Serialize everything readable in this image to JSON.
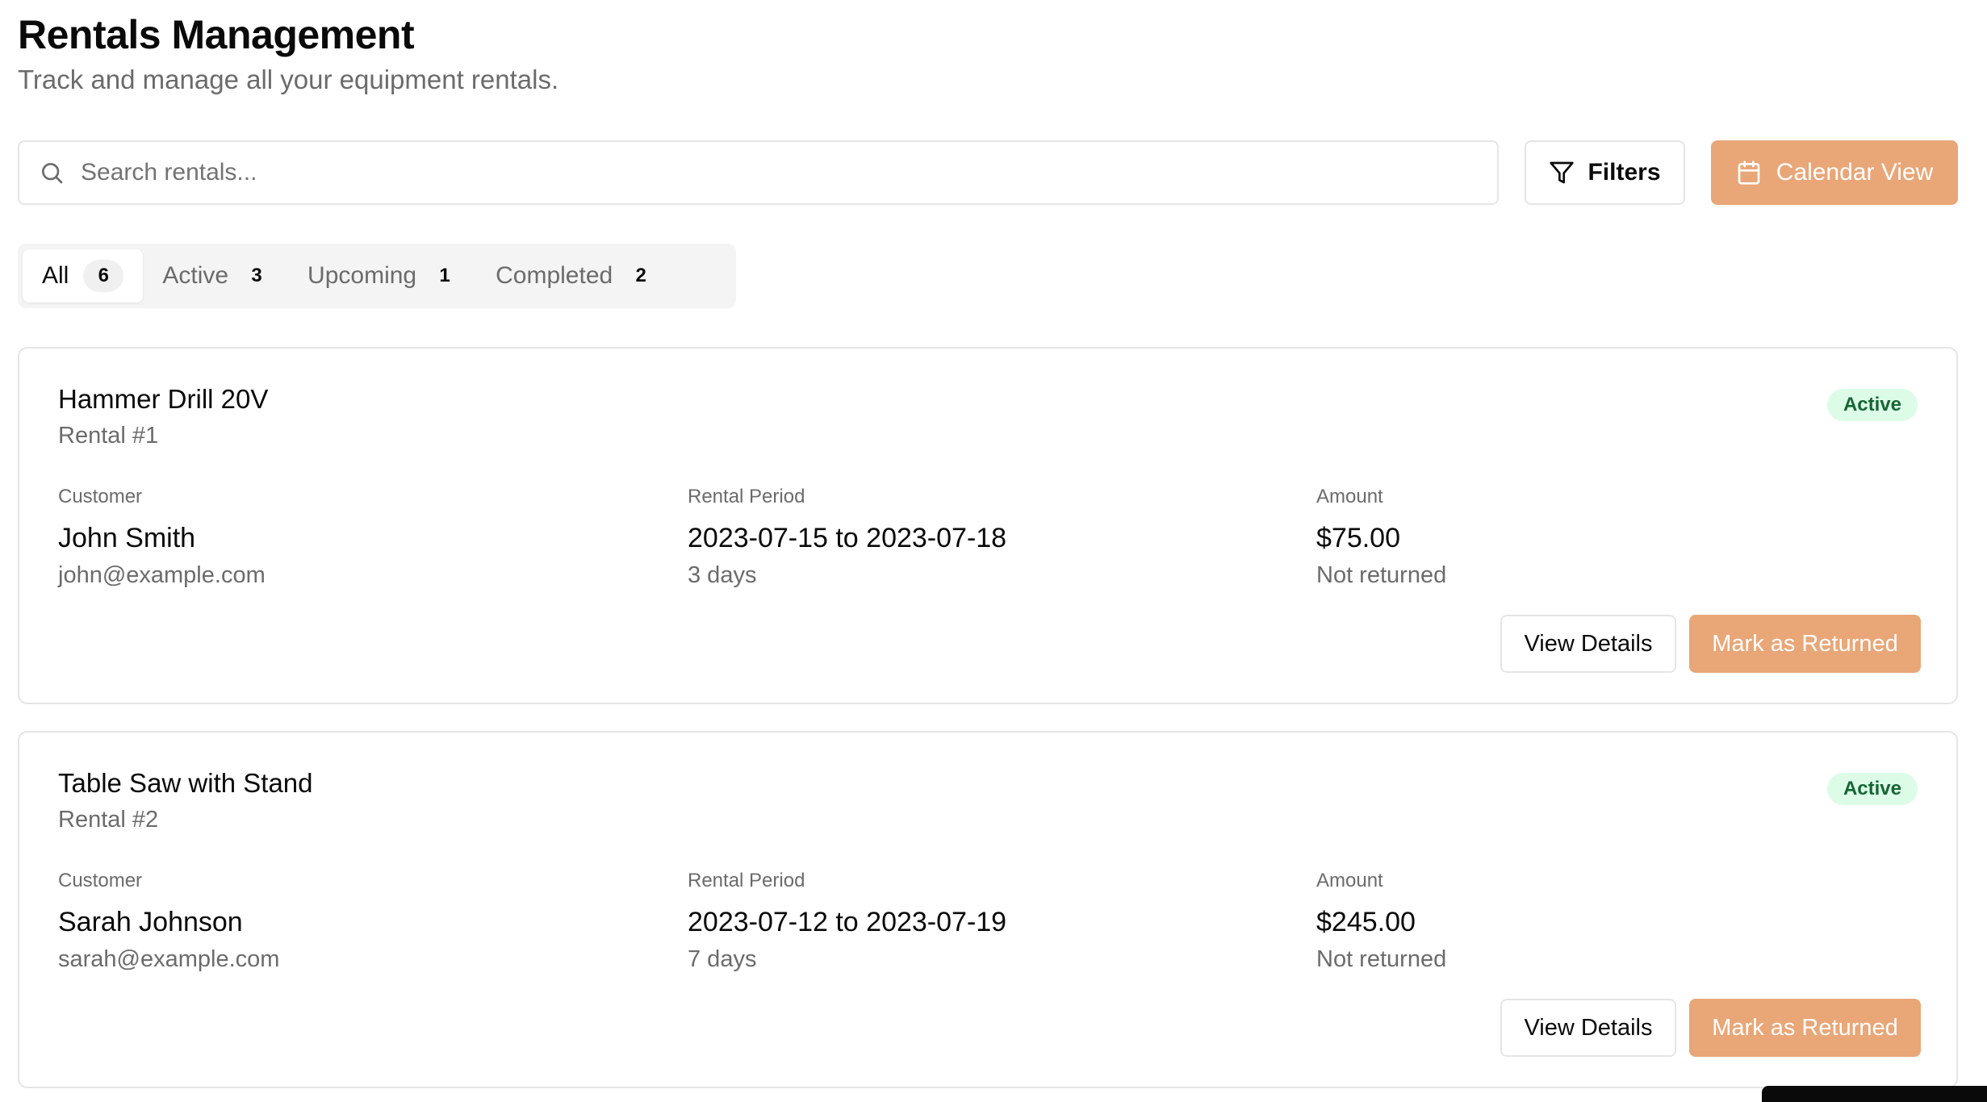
{
  "header": {
    "title": "Rentals Management",
    "subtitle": "Track and manage all your equipment rentals."
  },
  "toolbar": {
    "search_placeholder": "Search rentals...",
    "search_icon": "search-icon",
    "filters_label": "Filters",
    "filters_icon": "filter-icon",
    "calendar_label": "Calendar View",
    "calendar_icon": "calendar-icon"
  },
  "tabs": [
    {
      "label": "All",
      "count": "6",
      "active": true
    },
    {
      "label": "Active",
      "count": "3",
      "active": false
    },
    {
      "label": "Upcoming",
      "count": "1",
      "active": false
    },
    {
      "label": "Completed",
      "count": "2",
      "active": false
    }
  ],
  "rentals": [
    {
      "title": "Hammer Drill 20V",
      "rental_id": "Rental #1",
      "status": "Active",
      "customer_label": "Customer",
      "customer_name": "John Smith",
      "customer_email": "john@example.com",
      "period_label": "Rental Period",
      "period": "2023-07-15 to 2023-07-18",
      "duration": "3 days",
      "amount_label": "Amount",
      "amount": "$75.00",
      "return_status": "Not returned",
      "view_label": "View Details",
      "return_label": "Mark as Returned"
    },
    {
      "title": "Table Saw with Stand",
      "rental_id": "Rental #2",
      "status": "Active",
      "customer_label": "Customer",
      "customer_name": "Sarah Johnson",
      "customer_email": "sarah@example.com",
      "period_label": "Rental Period",
      "period": "2023-07-12 to 2023-07-19",
      "duration": "7 days",
      "amount_label": "Amount",
      "amount": "$245.00",
      "return_status": "Not returned",
      "view_label": "View Details",
      "return_label": "Mark as Returned"
    }
  ],
  "colors": {
    "accent": "#e9a677",
    "status_active_bg": "#dcfce7",
    "status_active_text": "#166534"
  }
}
